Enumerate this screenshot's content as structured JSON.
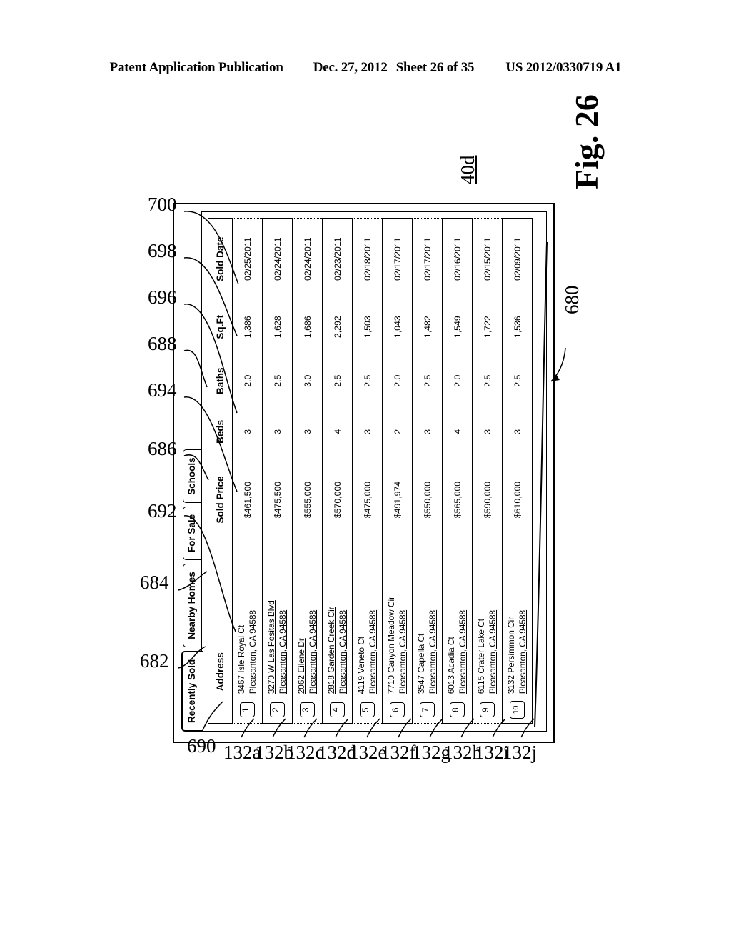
{
  "patent_header": {
    "publication": "Patent Application Publication",
    "date": "Dec. 27, 2012",
    "sheet": "Sheet 26 of 35",
    "number": "US 2012/0330719 A1"
  },
  "figure": {
    "label": "Fig. 26",
    "window_ref": "40d",
    "callout_ref": "680"
  },
  "window": {
    "tabs": [
      {
        "label": "Recently Sold",
        "active": true
      },
      {
        "label": "Nearby Homes",
        "active": false
      },
      {
        "label": "For Sale",
        "active": false
      },
      {
        "label": "Schools",
        "active": false
      }
    ]
  },
  "table": {
    "columns": [
      "",
      "Address",
      "Sold Price",
      "Beds",
      "Baths",
      "Sq.Ft",
      "Sold Date"
    ],
    "rows": [
      {
        "num": "1",
        "addr_line1": "3467 Isle Royal Ct",
        "addr_line2": "Pleasanton, CA 94588",
        "link": false,
        "price": "$461,500",
        "beds": "3",
        "baths": "2.0",
        "sqft": "1,386",
        "date": "02/25/2011"
      },
      {
        "num": "2",
        "addr_line1": "3270 W Las Positas Blvd",
        "addr_line2": "Pleasanton, CA 94588",
        "link": true,
        "price": "$475,500",
        "beds": "3",
        "baths": "2.5",
        "sqft": "1,628",
        "date": "02/24/2011"
      },
      {
        "num": "3",
        "addr_line1": "2062 Eilene Dr",
        "addr_line2": "Pleasanton, CA 94588",
        "link": true,
        "price": "$555,000",
        "beds": "3",
        "baths": "3.0",
        "sqft": "1,686",
        "date": "02/24/2011"
      },
      {
        "num": "4",
        "addr_line1": "2818 Garden Creek Cir",
        "addr_line2": "Pleasanton, CA 94588",
        "link": true,
        "price": "$570,000",
        "beds": "4",
        "baths": "2.5",
        "sqft": "2,292",
        "date": "02/23/2011"
      },
      {
        "num": "5",
        "addr_line1": "4119 Veneto Ct",
        "addr_line2": "Pleasanton, CA 94588",
        "link": true,
        "price": "$475,000",
        "beds": "3",
        "baths": "2.5",
        "sqft": "1,503",
        "date": "02/18/2011"
      },
      {
        "num": "6",
        "addr_line1": "7710 Canyon Meadow Cir",
        "addr_line2": "Pleasanton, CA 94588",
        "link": true,
        "price": "$491,974",
        "beds": "2",
        "baths": "2.0",
        "sqft": "1,043",
        "date": "02/17/2011"
      },
      {
        "num": "7",
        "addr_line1": "3547 Capella Ct",
        "addr_line2": "Pleasanton, CA 94588",
        "link": true,
        "price": "$550,000",
        "beds": "3",
        "baths": "2.5",
        "sqft": "1,482",
        "date": "02/17/2011"
      },
      {
        "num": "8",
        "addr_line1": "6013 Acadia Ct",
        "addr_line2": "Pleasanton, CA 94588",
        "link": true,
        "price": "$565,000",
        "beds": "4",
        "baths": "2.0",
        "sqft": "1,549",
        "date": "02/16/2011"
      },
      {
        "num": "9",
        "addr_line1": "6115 Crater Lake Ct",
        "addr_line2": "Pleasanton, CA 94588",
        "link": true,
        "price": "$590,000",
        "beds": "3",
        "baths": "2.5",
        "sqft": "1,722",
        "date": "02/15/2011"
      },
      {
        "num": "10",
        "addr_line1": "3132 Persimmon Cir",
        "addr_line2": "Pleasanton, CA 94588",
        "link": true,
        "price": "$610,000",
        "beds": "3",
        "baths": "2.5",
        "sqft": "1,536",
        "date": "02/09/2011"
      }
    ]
  },
  "reference_numerals": {
    "top": [
      "682",
      "684",
      "692",
      "686",
      "694",
      "688",
      "696",
      "698",
      "700"
    ],
    "left": [
      "690",
      "132a",
      "132b",
      "132c",
      "132d",
      "132e",
      "132f",
      "132g",
      "132h",
      "132i",
      "132j"
    ]
  }
}
